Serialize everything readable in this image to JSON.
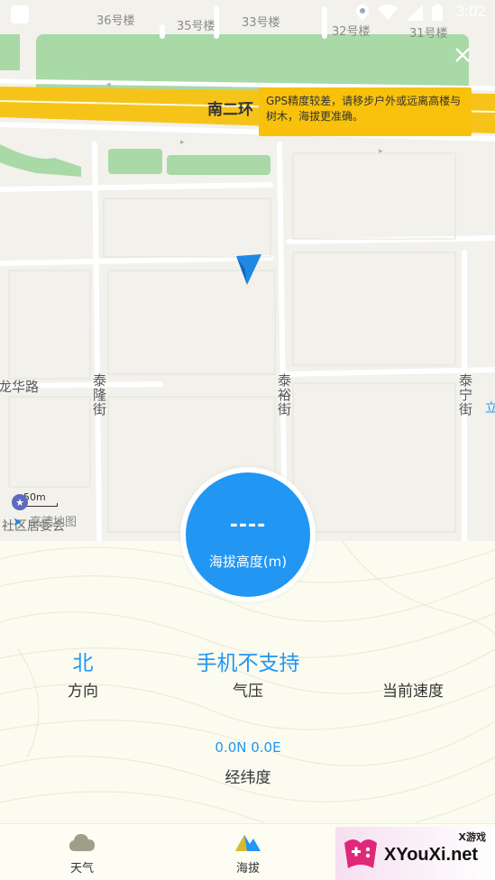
{
  "status_bar": {
    "time": "3:02"
  },
  "map": {
    "building_labels": [
      "36号楼",
      "35号楼",
      "33号楼",
      "32号楼",
      "31号楼"
    ],
    "ring_road": "南二环",
    "roads": [
      "泰隆街",
      "泰裕街",
      "泰宁街"
    ],
    "partial_road": "龙华路",
    "edge_text": "立",
    "poi_text": "社区居委会",
    "scale": "50m",
    "logo": "高德地图"
  },
  "gps_tip": "GPS精度较差，请移步户外或远离高楼与树木，海拔更准确。",
  "altitude": {
    "value": "----",
    "label": "海拔高度(m)"
  },
  "stats": {
    "direction": {
      "value": "北",
      "label": "方向"
    },
    "pressure": {
      "value": "手机不支持",
      "label": "气压"
    },
    "speed": {
      "value": "",
      "label": "当前速度"
    },
    "coords": {
      "value": "0.0N 0.0E",
      "label": "经纬度"
    }
  },
  "nav": {
    "weather": "天气",
    "altitude": "海拔"
  },
  "watermark": {
    "small": "X游戏",
    "main": "XYouXi.net"
  },
  "colors": {
    "accent": "#2196f3",
    "tip": "#f8c10c",
    "ring_road": "#f6c419",
    "green": "#a6d8a6"
  }
}
